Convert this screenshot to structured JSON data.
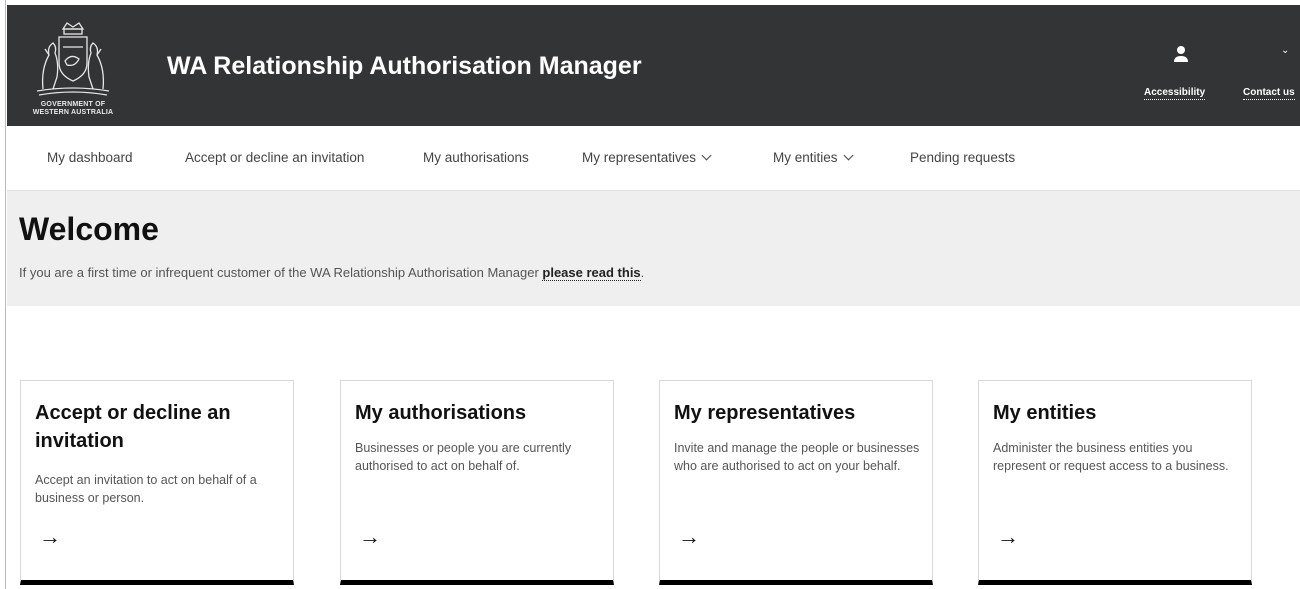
{
  "header": {
    "logo_caption_line1": "GOVERNMENT OF",
    "logo_caption_line2": "WESTERN AUSTRALIA",
    "logo_icon": "coat-of-arms",
    "title": "WA Relationship Authorisation Manager",
    "user_icon": "user-icon",
    "accessibility_label": "Accessibility",
    "contact_label": "Contact us",
    "bg_color": "#333435"
  },
  "nav": {
    "items": [
      {
        "label": "My dashboard"
      },
      {
        "label": "Accept or decline an invitation"
      },
      {
        "label": "My authorisations"
      },
      {
        "label": "My representatives"
      },
      {
        "label": "My entities"
      },
      {
        "label": "Pending requests"
      }
    ]
  },
  "welcome": {
    "title": "Welcome",
    "text": "If you are a first time or infrequent customer of the WA Relationship Authorisation Manager ",
    "link_label": "please read this",
    "trailing": "."
  },
  "cards": [
    {
      "title": "Accept or decline an invitation",
      "description": "Accept an invitation to act on behalf of a business or person.",
      "arrow": "→"
    },
    {
      "title": "My authorisations",
      "description": "Businesses or people you are currently authorised to act on behalf of.",
      "arrow": "→"
    },
    {
      "title": "My representatives",
      "description": "Invite and manage the people or businesses who are authorised to act on your behalf.",
      "arrow": "→"
    },
    {
      "title": "My entities",
      "description": "Administer the business entities you represent or request access to a business.",
      "arrow": "→"
    }
  ]
}
